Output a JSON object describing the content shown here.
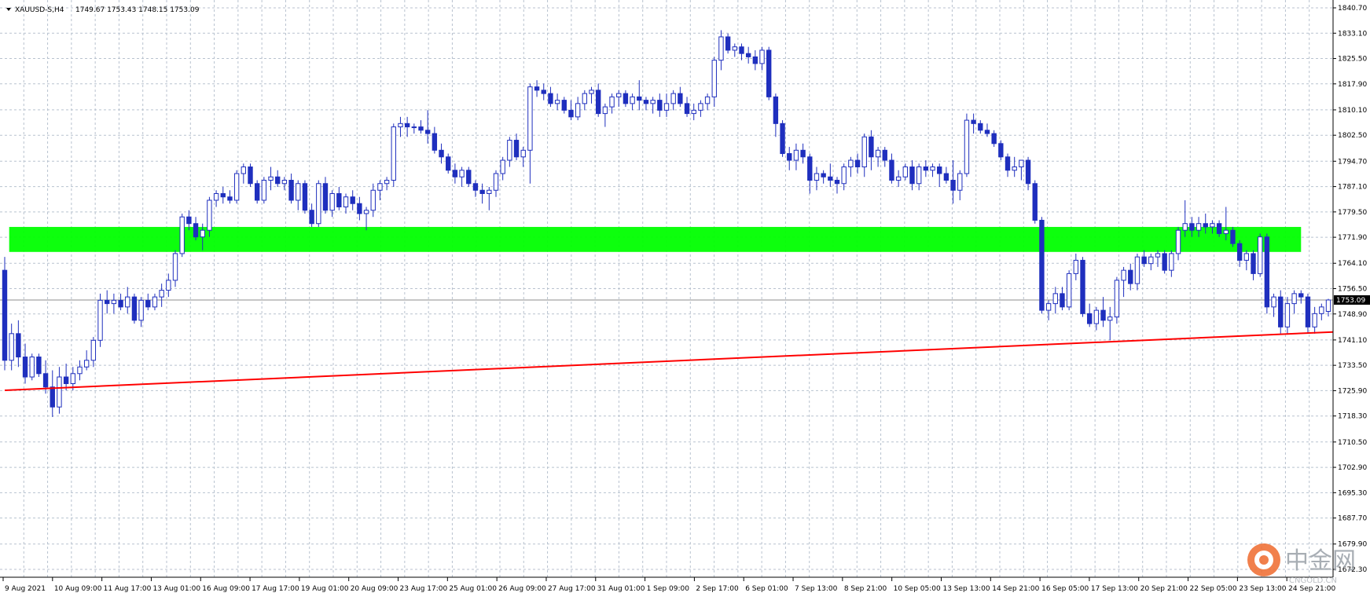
{
  "header": {
    "symbol": "XAUUSD-S,H4",
    "ohlc": "1749.67 1753.43 1748.15 1753.09"
  },
  "watermark": {
    "brand_cn": "中金网",
    "brand_en": "CNGOLD.CN"
  },
  "colors": {
    "candle": "#1f2fbe",
    "grid": "#b8c2cf",
    "zone": "#00ff00",
    "trendline": "#ff0000",
    "price_line": "#8c8c8c",
    "price_label_bg": "#000000"
  },
  "chart_data": {
    "type": "candlestick",
    "title": "",
    "ylim": [
      1672.3,
      1840.7
    ],
    "y_ticks": [
      "1840.70",
      "1833.10",
      "1825.50",
      "1817.90",
      "1810.10",
      "1802.50",
      "1794.70",
      "1787.10",
      "1779.50",
      "1771.90",
      "1764.10",
      "1756.50",
      "1748.90",
      "1741.10",
      "1733.50",
      "1725.90",
      "1718.30",
      "1710.50",
      "1702.90",
      "1695.30",
      "1687.70",
      "1679.90",
      "1672.30"
    ],
    "x_ticks": [
      "9 Aug 2021",
      "10 Aug 09:00",
      "11 Aug 17:00",
      "13 Aug 01:00",
      "16 Aug 09:00",
      "17 Aug 17:00",
      "19 Aug 01:00",
      "20 Aug 09:00",
      "23 Aug 17:00",
      "25 Aug 01:00",
      "26 Aug 09:00",
      "27 Aug 17:00",
      "31 Aug 01:00",
      "1 Sep 09:00",
      "2 Sep 17:00",
      "6 Sep 01:00",
      "7 Sep 13:00",
      "8 Sep 21:00",
      "10 Sep 05:00",
      "13 Sep 13:00",
      "14 Sep 21:00",
      "16 Sep 05:00",
      "17 Sep 13:00",
      "20 Sep 21:00",
      "22 Sep 05:00",
      "23 Sep 13:00",
      "24 Sep 21:00"
    ],
    "current_price": "1753.09",
    "resistance_zone": [
      1767.5,
      1775.0
    ],
    "trendline": {
      "from": 1726.0,
      "to": 1743.5
    },
    "candles": [
      [
        1762,
        1766,
        1732,
        1735
      ],
      [
        1735,
        1746,
        1732,
        1743
      ],
      [
        1743,
        1747,
        1733,
        1736
      ],
      [
        1736,
        1740,
        1728,
        1730
      ],
      [
        1730,
        1737,
        1729,
        1736
      ],
      [
        1736,
        1737,
        1730,
        1731
      ],
      [
        1731,
        1735,
        1725,
        1727
      ],
      [
        1727,
        1732,
        1718,
        1721
      ],
      [
        1721,
        1733,
        1719,
        1730
      ],
      [
        1730,
        1734,
        1726,
        1728
      ],
      [
        1728,
        1733,
        1726,
        1731
      ],
      [
        1731,
        1735,
        1729,
        1733
      ],
      [
        1733,
        1738,
        1732,
        1735
      ],
      [
        1735,
        1742,
        1733,
        1741
      ],
      [
        1741,
        1755,
        1739,
        1753
      ],
      [
        1753,
        1756,
        1749,
        1752
      ],
      [
        1752,
        1755,
        1749,
        1753
      ],
      [
        1753,
        1755,
        1750,
        1751
      ],
      [
        1751,
        1757,
        1749,
        1754
      ],
      [
        1754,
        1755,
        1746,
        1747
      ],
      [
        1747,
        1754,
        1745,
        1753
      ],
      [
        1753,
        1755,
        1750,
        1751
      ],
      [
        1751,
        1755,
        1750,
        1754
      ],
      [
        1754,
        1758,
        1751,
        1756
      ],
      [
        1756,
        1761,
        1754,
        1759
      ],
      [
        1759,
        1768,
        1757,
        1767
      ],
      [
        1767,
        1779,
        1766,
        1778
      ],
      [
        1778,
        1780,
        1774,
        1776
      ],
      [
        1776,
        1778,
        1771,
        1772
      ],
      [
        1772,
        1776,
        1768,
        1774
      ],
      [
        1774,
        1784,
        1772,
        1783
      ],
      [
        1783,
        1786,
        1781,
        1785
      ],
      [
        1785,
        1787,
        1782,
        1784
      ],
      [
        1784,
        1786,
        1782,
        1783
      ],
      [
        1783,
        1792,
        1782,
        1791
      ],
      [
        1791,
        1794,
        1788,
        1793
      ],
      [
        1793,
        1794,
        1787,
        1788
      ],
      [
        1788,
        1789,
        1782,
        1783
      ],
      [
        1783,
        1790,
        1782,
        1789
      ],
      [
        1789,
        1793,
        1786,
        1790
      ],
      [
        1790,
        1792,
        1787,
        1788
      ],
      [
        1788,
        1790,
        1786,
        1789
      ],
      [
        1789,
        1791,
        1782,
        1783
      ],
      [
        1783,
        1789,
        1780,
        1788
      ],
      [
        1788,
        1789,
        1779,
        1780
      ],
      [
        1780,
        1782,
        1775,
        1776
      ],
      [
        1776,
        1789,
        1775,
        1788
      ],
      [
        1788,
        1790,
        1779,
        1780
      ],
      [
        1780,
        1786,
        1778,
        1785
      ],
      [
        1785,
        1787,
        1780,
        1781
      ],
      [
        1781,
        1785,
        1779,
        1784
      ],
      [
        1784,
        1786,
        1780,
        1782
      ],
      [
        1782,
        1784,
        1777,
        1779
      ],
      [
        1779,
        1781,
        1774,
        1780
      ],
      [
        1780,
        1788,
        1778,
        1786
      ],
      [
        1786,
        1789,
        1783,
        1788
      ],
      [
        1788,
        1790,
        1786,
        1789
      ],
      [
        1789,
        1806,
        1787,
        1805
      ],
      [
        1805,
        1808,
        1802,
        1806
      ],
      [
        1806,
        1808,
        1802,
        1805
      ],
      [
        1805,
        1806,
        1803,
        1805
      ],
      [
        1805,
        1807,
        1803,
        1804
      ],
      [
        1804,
        1810,
        1800,
        1803
      ],
      [
        1803,
        1805,
        1797,
        1798
      ],
      [
        1798,
        1800,
        1794,
        1796
      ],
      [
        1796,
        1797,
        1791,
        1792
      ],
      [
        1792,
        1794,
        1788,
        1790
      ],
      [
        1790,
        1793,
        1787,
        1792
      ],
      [
        1792,
        1793,
        1787,
        1788
      ],
      [
        1788,
        1789,
        1784,
        1786
      ],
      [
        1786,
        1788,
        1782,
        1785
      ],
      [
        1785,
        1787,
        1780,
        1786
      ],
      [
        1786,
        1792,
        1784,
        1791
      ],
      [
        1791,
        1796,
        1789,
        1795
      ],
      [
        1795,
        1802,
        1793,
        1801
      ],
      [
        1801,
        1803,
        1795,
        1796
      ],
      [
        1796,
        1799,
        1793,
        1798
      ],
      [
        1798,
        1818,
        1788,
        1817
      ],
      [
        1817,
        1819,
        1814,
        1816
      ],
      [
        1816,
        1818,
        1813,
        1815
      ],
      [
        1815,
        1817,
        1811,
        1812
      ],
      [
        1812,
        1815,
        1810,
        1813
      ],
      [
        1813,
        1814,
        1809,
        1810
      ],
      [
        1810,
        1813,
        1807,
        1808
      ],
      [
        1808,
        1814,
        1807,
        1812
      ],
      [
        1812,
        1816,
        1810,
        1815
      ],
      [
        1815,
        1817,
        1812,
        1816
      ],
      [
        1816,
        1818,
        1808,
        1809
      ],
      [
        1809,
        1812,
        1805,
        1811
      ],
      [
        1811,
        1815,
        1809,
        1814
      ],
      [
        1814,
        1816,
        1811,
        1815
      ],
      [
        1815,
        1816,
        1811,
        1812
      ],
      [
        1812,
        1815,
        1810,
        1814
      ],
      [
        1814,
        1819,
        1810,
        1813
      ],
      [
        1813,
        1814,
        1810,
        1812
      ],
      [
        1812,
        1814,
        1809,
        1813
      ],
      [
        1813,
        1815,
        1808,
        1810
      ],
      [
        1810,
        1815,
        1808,
        1812
      ],
      [
        1812,
        1816,
        1810,
        1815
      ],
      [
        1815,
        1817,
        1811,
        1812
      ],
      [
        1812,
        1814,
        1808,
        1809
      ],
      [
        1809,
        1812,
        1807,
        1810
      ],
      [
        1810,
        1813,
        1808,
        1812
      ],
      [
        1812,
        1815,
        1810,
        1814
      ],
      [
        1814,
        1826,
        1811,
        1825
      ],
      [
        1825,
        1834,
        1822,
        1832
      ],
      [
        1832,
        1833,
        1827,
        1828
      ],
      [
        1828,
        1830,
        1826,
        1829
      ],
      [
        1829,
        1830,
        1825,
        1827
      ],
      [
        1827,
        1829,
        1824,
        1826
      ],
      [
        1826,
        1828,
        1822,
        1824
      ],
      [
        1824,
        1829,
        1822,
        1828
      ],
      [
        1828,
        1829,
        1813,
        1814
      ],
      [
        1814,
        1815,
        1802,
        1806
      ],
      [
        1806,
        1807,
        1796,
        1797
      ],
      [
        1797,
        1799,
        1792,
        1795
      ],
      [
        1795,
        1800,
        1792,
        1798
      ],
      [
        1798,
        1800,
        1794,
        1796
      ],
      [
        1796,
        1797,
        1785,
        1789
      ],
      [
        1789,
        1793,
        1786,
        1791
      ],
      [
        1791,
        1792,
        1788,
        1790
      ],
      [
        1790,
        1794,
        1787,
        1789
      ],
      [
        1789,
        1790,
        1785,
        1788
      ],
      [
        1788,
        1794,
        1786,
        1793
      ],
      [
        1793,
        1796,
        1790,
        1795
      ],
      [
        1795,
        1797,
        1791,
        1793
      ],
      [
        1793,
        1803,
        1790,
        1802
      ],
      [
        1802,
        1804,
        1792,
        1796
      ],
      [
        1796,
        1799,
        1793,
        1798
      ],
      [
        1798,
        1799,
        1793,
        1795
      ],
      [
        1795,
        1797,
        1788,
        1789
      ],
      [
        1789,
        1792,
        1787,
        1790
      ],
      [
        1790,
        1794,
        1789,
        1793
      ],
      [
        1793,
        1795,
        1786,
        1788
      ],
      [
        1788,
        1794,
        1786,
        1793
      ],
      [
        1793,
        1795,
        1790,
        1792
      ],
      [
        1792,
        1794,
        1790,
        1793
      ],
      [
        1793,
        1794,
        1787,
        1791
      ],
      [
        1791,
        1793,
        1788,
        1789
      ],
      [
        1789,
        1795,
        1782,
        1786
      ],
      [
        1786,
        1792,
        1783,
        1791
      ],
      [
        1791,
        1809,
        1790,
        1807
      ],
      [
        1807,
        1809,
        1803,
        1806
      ],
      [
        1806,
        1807,
        1803,
        1804
      ],
      [
        1804,
        1806,
        1802,
        1803
      ],
      [
        1803,
        1804,
        1799,
        1800
      ],
      [
        1800,
        1801,
        1795,
        1796
      ],
      [
        1796,
        1797,
        1790,
        1792
      ],
      [
        1792,
        1796,
        1790,
        1793
      ],
      [
        1793,
        1795,
        1789,
        1795
      ],
      [
        1795,
        1796,
        1786,
        1788
      ],
      [
        1788,
        1789,
        1776,
        1777
      ],
      [
        1777,
        1778,
        1749,
        1750
      ],
      [
        1750,
        1753,
        1747,
        1752
      ],
      [
        1752,
        1757,
        1749,
        1755
      ],
      [
        1755,
        1757,
        1750,
        1751
      ],
      [
        1751,
        1762,
        1750,
        1761
      ],
      [
        1761,
        1767,
        1759,
        1765
      ],
      [
        1765,
        1766,
        1748,
        1749
      ],
      [
        1749,
        1752,
        1745,
        1746
      ],
      [
        1746,
        1751,
        1744,
        1750
      ],
      [
        1750,
        1754,
        1745,
        1747
      ],
      [
        1747,
        1751,
        1741,
        1748
      ],
      [
        1748,
        1760,
        1746,
        1759
      ],
      [
        1759,
        1763,
        1754,
        1762
      ],
      [
        1762,
        1764,
        1756,
        1758
      ],
      [
        1758,
        1767,
        1756,
        1766
      ],
      [
        1766,
        1768,
        1763,
        1764
      ],
      [
        1764,
        1767,
        1762,
        1766
      ],
      [
        1766,
        1768,
        1763,
        1767
      ],
      [
        1767,
        1768,
        1761,
        1762
      ],
      [
        1762,
        1768,
        1760,
        1767
      ],
      [
        1767,
        1775,
        1765,
        1774
      ],
      [
        1774,
        1783,
        1772,
        1776
      ],
      [
        1776,
        1778,
        1772,
        1774
      ],
      [
        1774,
        1778,
        1772,
        1776
      ],
      [
        1776,
        1779,
        1773,
        1775
      ],
      [
        1775,
        1777,
        1773,
        1776
      ],
      [
        1776,
        1777,
        1772,
        1773
      ],
      [
        1773,
        1781,
        1771,
        1774
      ],
      [
        1774,
        1775,
        1769,
        1770
      ],
      [
        1770,
        1771,
        1763,
        1765
      ],
      [
        1765,
        1768,
        1762,
        1767
      ],
      [
        1767,
        1768,
        1759,
        1761
      ],
      [
        1761,
        1773,
        1760,
        1772
      ],
      [
        1772,
        1773,
        1749,
        1751
      ],
      [
        1751,
        1755,
        1748,
        1754
      ],
      [
        1754,
        1756,
        1743,
        1745
      ],
      [
        1745,
        1754,
        1743,
        1752
      ],
      [
        1752,
        1756,
        1749,
        1755
      ],
      [
        1755,
        1756,
        1752,
        1754
      ],
      [
        1754,
        1755,
        1743,
        1745
      ],
      [
        1745,
        1751,
        1743,
        1749
      ],
      [
        1749,
        1752,
        1747,
        1751
      ],
      [
        1749.67,
        1753.43,
        1748.15,
        1753.09
      ]
    ]
  }
}
